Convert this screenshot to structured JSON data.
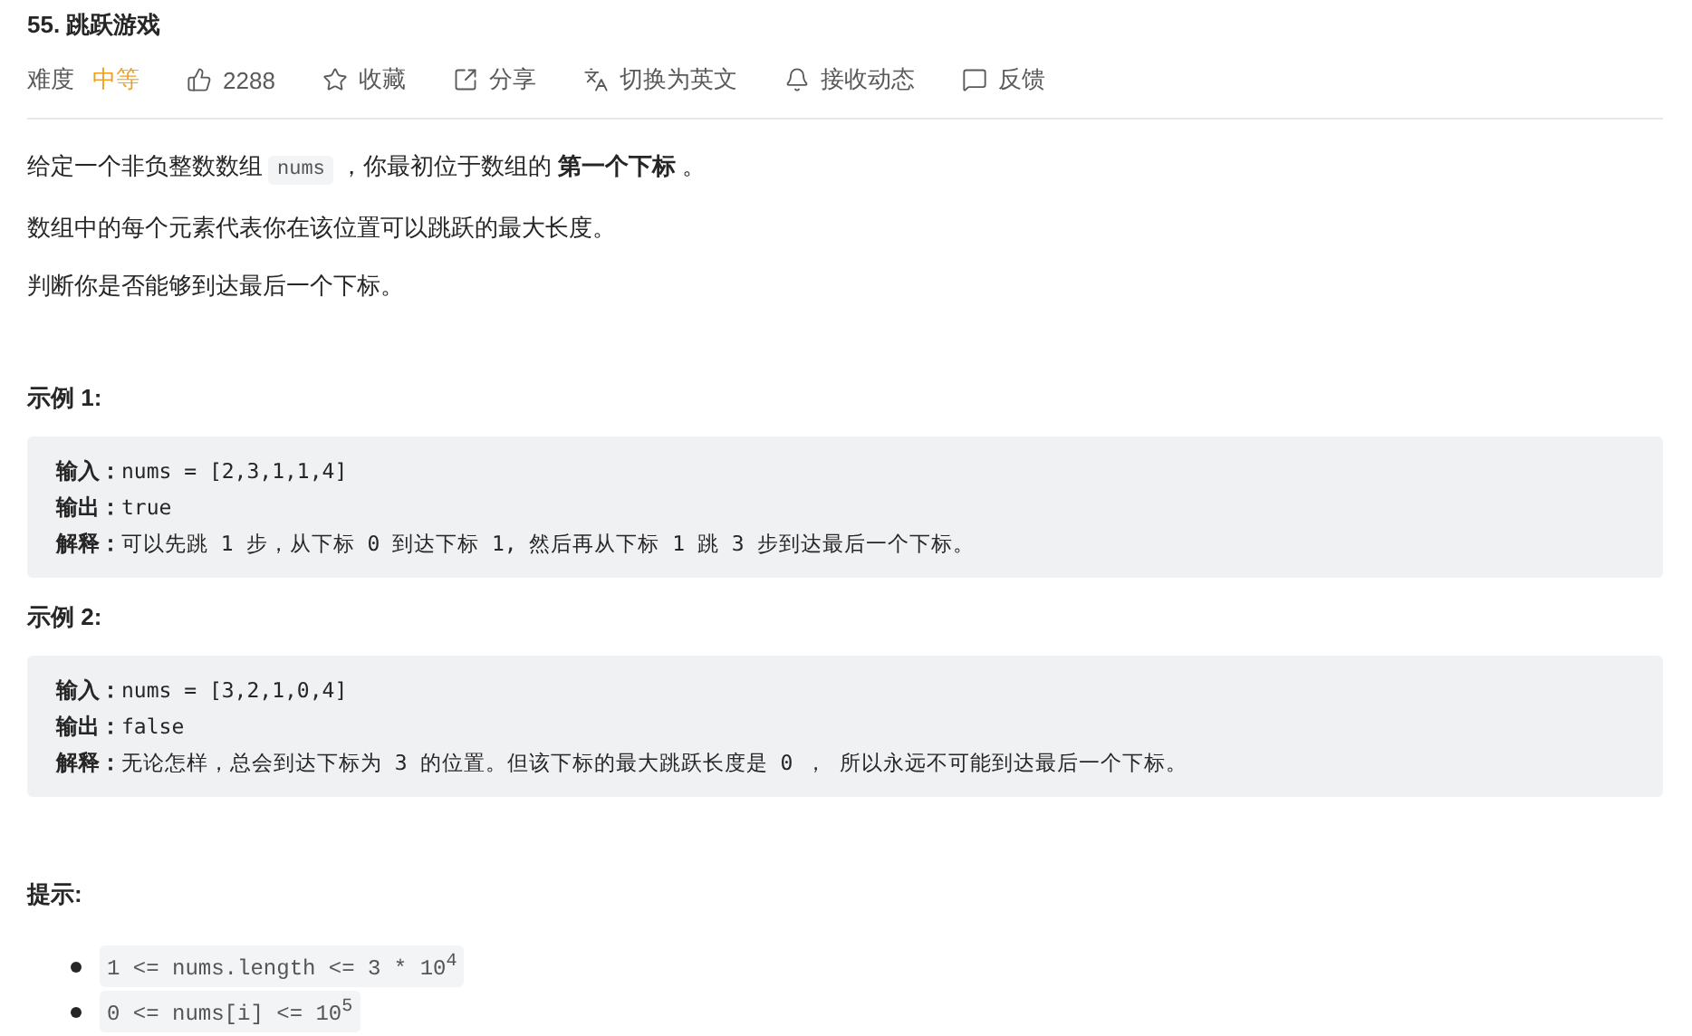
{
  "title": "55. 跳跃游戏",
  "toolbar": {
    "difficulty_label": "难度",
    "difficulty": "中等",
    "actions": [
      {
        "label": "2288"
      },
      {
        "label": "收藏"
      },
      {
        "label": "分享"
      },
      {
        "label": "切换为英文"
      },
      {
        "label": "接收动态"
      },
      {
        "label": "反馈"
      }
    ]
  },
  "description": {
    "intro": {
      "before": "给定一个非负整数数组",
      "code": "nums",
      "after": "，你最初位于数组的 **第一个下标** 。"
    },
    "paragraphs": [
      "数组中的每个元素代表你在该位置可以跳跃的最大长度。",
      "判断你是否能够到达最后一个下标。"
    ]
  },
  "examples": [
    {
      "heading": "示例 1:",
      "lines": [
        {
          "label": "输入：",
          "value": "nums = [2,3,1,1,4]"
        },
        {
          "label": "输出：",
          "value": "true"
        },
        {
          "label": "解释：",
          "value": "可以先跳 1 步，从下标 0 到达下标 1, 然后再从下标 1 跳 3 步到达最后一个下标。"
        }
      ]
    },
    {
      "heading": "示例 2:",
      "lines": [
        {
          "label": "输入：",
          "value": "nums = [3,2,1,0,4]"
        },
        {
          "label": "输出：",
          "value": "false"
        },
        {
          "label": "解释：",
          "value": "无论怎样，总会到达下标为 3 的位置。但该下标的最大跳跃长度是 0 ， 所以永远不可能到达最后一个下标。"
        }
      ]
    }
  ],
  "hints": {
    "heading": "提示:",
    "items": [
      "1 <= nums.length <= 3 * 10$^{4}$",
      "0 <= nums[i] <= 10$^{5}$"
    ]
  }
}
